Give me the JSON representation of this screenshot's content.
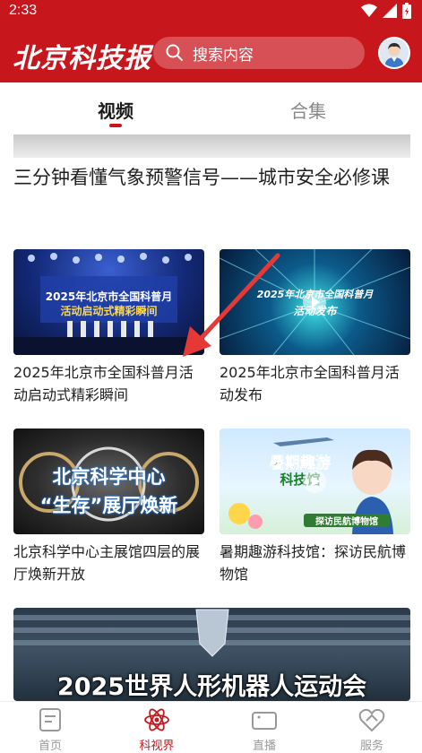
{
  "status_bar": {
    "time": "2:33"
  },
  "header": {
    "logo_text": "北京科技报",
    "search_placeholder": "搜索内容"
  },
  "tabs": [
    {
      "label": "视频",
      "active": true
    },
    {
      "label": "合集",
      "active": false
    }
  ],
  "featured": {
    "title": "三分钟看懂气象预警信号——城市安全必修课"
  },
  "videos": [
    {
      "title": "2025年北京市全国科普月活动启动式精彩瞬间",
      "overlay_line1": "2025年北京市全国科普月",
      "overlay_line2": "活动启动式精彩瞬间"
    },
    {
      "title": "2025年北京市全国科普月活动发布",
      "overlay_line1": "2025年北京市全国科普月",
      "overlay_line2": "活动发布"
    },
    {
      "title": "北京科学中心主展馆四层的展厅焕新开放",
      "overlay_line1": "北京科学中心",
      "overlay_line2": "“生存”展厅焕新"
    },
    {
      "title": "暑期趣游科技馆：探访民航博物馆",
      "overlay_line1": "暑期趣游",
      "overlay_line2": "科技馆",
      "overlay_line3": "探访民航博物馆"
    }
  ],
  "bottom_banner": {
    "overlay_text": "2025世界人形机器人运动会"
  },
  "bottom_nav": [
    {
      "label": "首页",
      "icon": "home-doc-icon",
      "active": false
    },
    {
      "label": "科视界",
      "icon": "atom-icon",
      "active": true
    },
    {
      "label": "直播",
      "icon": "video-camera-icon",
      "active": false
    },
    {
      "label": "服务",
      "icon": "service-icon",
      "active": false
    }
  ],
  "colors": {
    "brand": "#c8161d",
    "inactive": "#999999"
  }
}
